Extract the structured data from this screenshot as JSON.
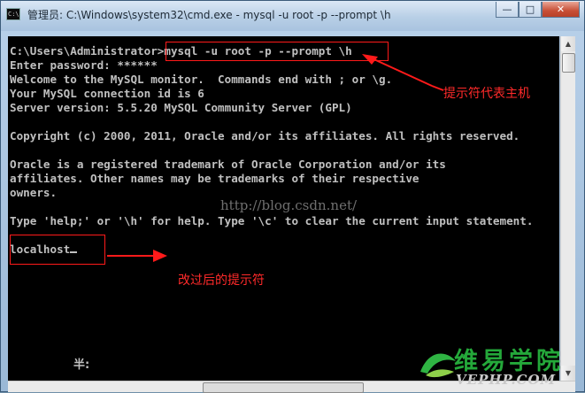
{
  "window": {
    "title": "管理员: C:\\Windows\\system32\\cmd.exe - mysql  -u root -p --prompt \\h",
    "icon": "console-icon",
    "controls": {
      "minimize": "—",
      "maximize": "□",
      "close": "✕"
    }
  },
  "console": {
    "lines": [
      "",
      "C:\\Users\\Administrator>mysql -u root -p --prompt \\h",
      "Enter password: ******",
      "Welcome to the MySQL monitor.  Commands end with ; or \\g.",
      "Your MySQL connection id is 6",
      "Server version: 5.5.20 MySQL Community Server (GPL)",
      "",
      "Copyright (c) 2000, 2011, Oracle and/or its affiliates. All rights reserved.",
      "",
      "Oracle is a registered trademark of Oracle Corporation and/or its",
      "affiliates. Other names may be trademarks of their respective",
      "owners.",
      "",
      "Type 'help;' or '\\h' for help. Type '\\c' to clear the current input statement.",
      "",
      "localhost"
    ],
    "ime_status": "半:",
    "text_color": "#c0c0c0",
    "background": "#000000"
  },
  "annotations": {
    "prompt_caption": "提示符代表主机",
    "result_caption": "改过后的提示符",
    "color": "#ff1a1a"
  },
  "watermark": "http://blog.csdn.net/",
  "logo": {
    "name": "维易学院",
    "url": "VEPHP.COM",
    "color": "#24a83a"
  }
}
